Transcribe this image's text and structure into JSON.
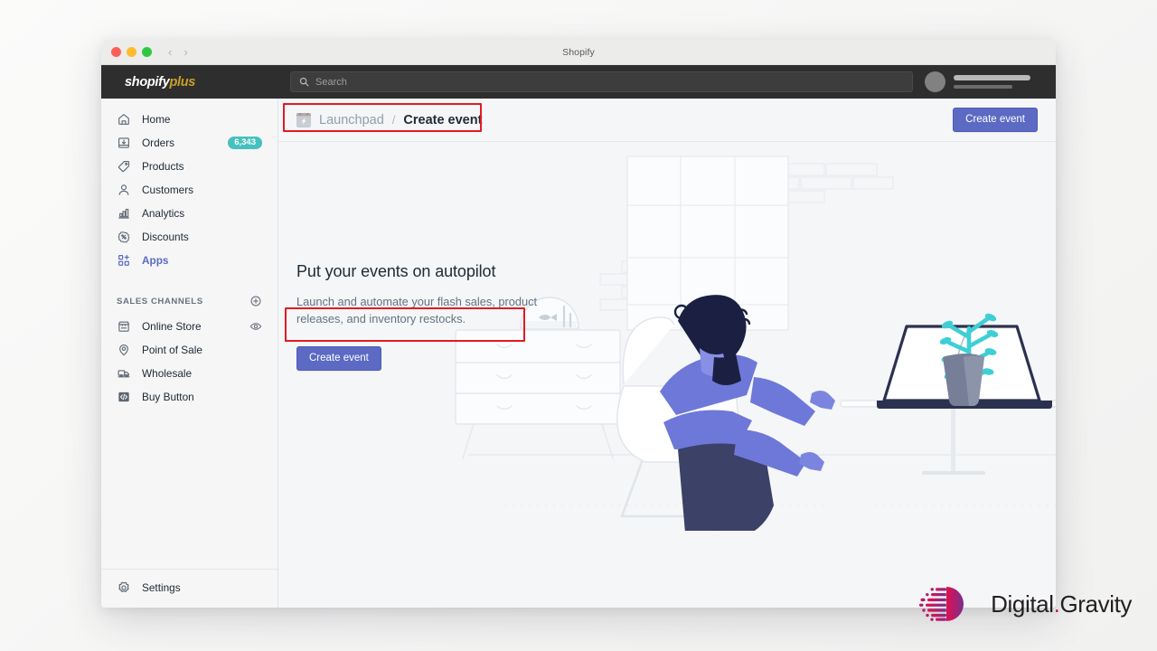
{
  "window": {
    "title": "Shopify",
    "traffic_lights": [
      "close-red",
      "minimize-yellow",
      "zoom-green"
    ],
    "back_arrow": "‹",
    "forward_arrow": "›"
  },
  "topbar": {
    "brand_primary": "shopify",
    "brand_secondary": "plus",
    "search": {
      "placeholder": "Search",
      "value": "",
      "icon": "search-icon"
    },
    "user": {
      "avatar": "avatar-placeholder",
      "name_placeholder": "",
      "store_placeholder": ""
    }
  },
  "sidebar": {
    "items": [
      {
        "label": "Home",
        "icon": "home-icon",
        "badge": "",
        "active": false
      },
      {
        "label": "Orders",
        "icon": "orders-icon",
        "badge": "6,343",
        "active": false
      },
      {
        "label": "Products",
        "icon": "products-tag-icon",
        "badge": "",
        "active": false
      },
      {
        "label": "Customers",
        "icon": "customers-icon",
        "badge": "",
        "active": false
      },
      {
        "label": "Analytics",
        "icon": "analytics-bars-icon",
        "badge": "",
        "active": false
      },
      {
        "label": "Discounts",
        "icon": "discounts-icon",
        "badge": "",
        "active": false
      },
      {
        "label": "Apps",
        "icon": "apps-grid-icon",
        "badge": "",
        "active": true
      }
    ],
    "section": {
      "title": "SALES CHANNELS",
      "add_icon": "plus-circle-icon",
      "items": [
        {
          "label": "Online Store",
          "icon": "storefront-icon",
          "trailing_icon": "eye-icon"
        },
        {
          "label": "Point of Sale",
          "icon": "location-pin-icon",
          "trailing_icon": ""
        },
        {
          "label": "Wholesale",
          "icon": "truck-icon",
          "trailing_icon": ""
        },
        {
          "label": "Buy Button",
          "icon": "code-brackets-icon",
          "trailing_icon": ""
        }
      ]
    },
    "footer": {
      "label": "Settings",
      "icon": "gear-icon"
    }
  },
  "page": {
    "breadcrumb": {
      "app_icon": "launchpad-app-icon",
      "parent": "Launchpad",
      "separator": "/",
      "current": "Create event"
    },
    "header_button": "Create event",
    "empty_state": {
      "heading": "Put your events on autopilot",
      "description": "Launch and automate your flash sales, product releases, and inventory restocks.",
      "cta": "Create event",
      "illustration": "person-at-desk-with-laptop-illustration"
    }
  },
  "annotations": [
    {
      "name": "breadcrumb-highlight",
      "color": "#e01b22"
    },
    {
      "name": "description-highlight",
      "color": "#e01b22"
    }
  ],
  "watermark": {
    "name_first": "Digital",
    "dot": ".",
    "name_second": "Gravity",
    "mark": "digital-gravity-logo-icon",
    "gradient_from": "#e0114e",
    "gradient_to": "#7b2d8e"
  },
  "colors": {
    "accent": "#5c6ac4",
    "badge": "#47c1bf",
    "annotation": "#e01b22",
    "topbar": "#2e2e2e",
    "sidebar": "#f6f6f7",
    "canvas": "#f4f6f8"
  }
}
